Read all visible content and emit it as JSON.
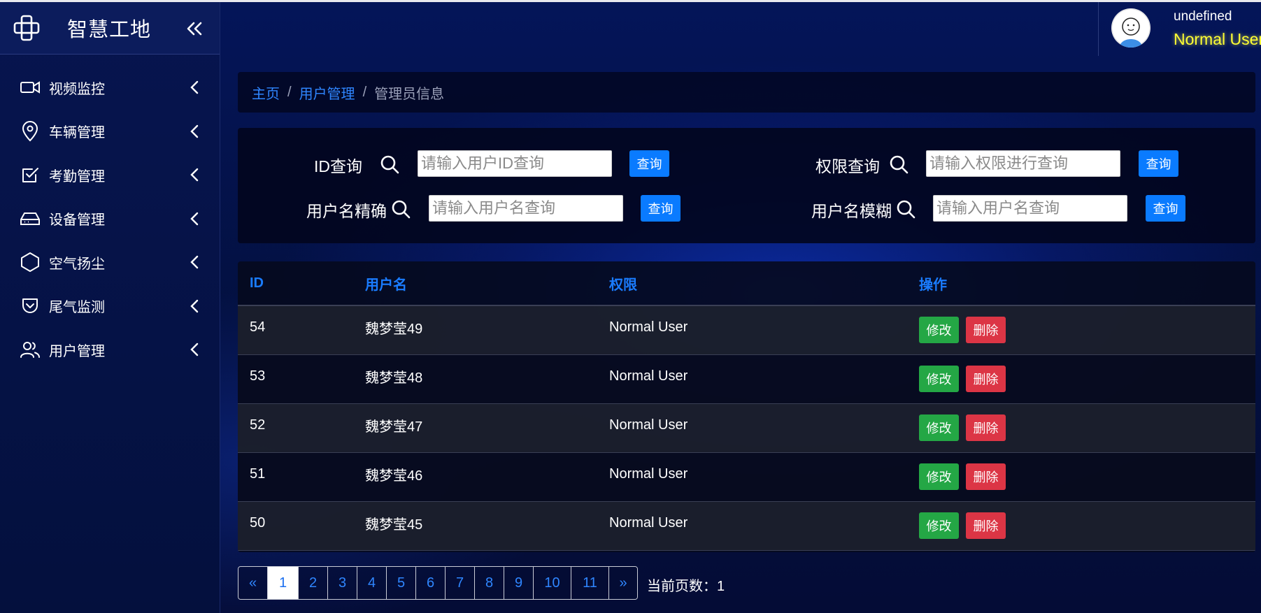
{
  "brand": {
    "title": "智慧工地"
  },
  "sidebar": {
    "items": [
      {
        "label": "视频监控",
        "icon": "video-camera-icon"
      },
      {
        "label": "车辆管理",
        "icon": "location-pin-icon"
      },
      {
        "label": "考勤管理",
        "icon": "checkbox-icon"
      },
      {
        "label": "设备管理",
        "icon": "hard-drive-icon"
      },
      {
        "label": "空气扬尘",
        "icon": "hexagon-icon"
      },
      {
        "label": "尾气监测",
        "icon": "shield-check-icon"
      },
      {
        "label": "用户管理",
        "icon": "users-icon"
      }
    ]
  },
  "user": {
    "name": "undefined",
    "role": "Normal User"
  },
  "breadcrumb": {
    "home": "主页",
    "section": "用户管理",
    "current": "管理员信息",
    "separator": "/"
  },
  "search": {
    "id": {
      "label": "ID查询",
      "placeholder": "请输入用户ID查询",
      "button": "查询"
    },
    "permission": {
      "label": "权限查询",
      "placeholder": "请输入权限进行查询",
      "button": "查询"
    },
    "username_exact": {
      "label": "用户名精确",
      "placeholder": "请输入用户名查询",
      "button": "查询"
    },
    "username_fuzzy": {
      "label": "用户名模糊",
      "placeholder": "请输入用户名查询",
      "button": "查询"
    }
  },
  "table": {
    "headers": [
      "ID",
      "用户名",
      "权限",
      "操作"
    ],
    "edit_label": "修改",
    "delete_label": "删除",
    "rows": [
      {
        "id": "54",
        "username": "魏梦莹49",
        "permission": "Normal User"
      },
      {
        "id": "53",
        "username": "魏梦莹48",
        "permission": "Normal User"
      },
      {
        "id": "52",
        "username": "魏梦莹47",
        "permission": "Normal User"
      },
      {
        "id": "51",
        "username": "魏梦莹46",
        "permission": "Normal User"
      },
      {
        "id": "50",
        "username": "魏梦莹45",
        "permission": "Normal User"
      }
    ]
  },
  "pagination": {
    "prev": "«",
    "pages": [
      "1",
      "2",
      "3",
      "4",
      "5",
      "6",
      "7",
      "8",
      "9",
      "10",
      "11"
    ],
    "active": "1",
    "next": "»",
    "current_label": "当前页数：1"
  },
  "colors": {
    "accent": "#0a7bff",
    "edit": "#24a745",
    "delete": "#dc3545",
    "role": "#ffff33"
  }
}
